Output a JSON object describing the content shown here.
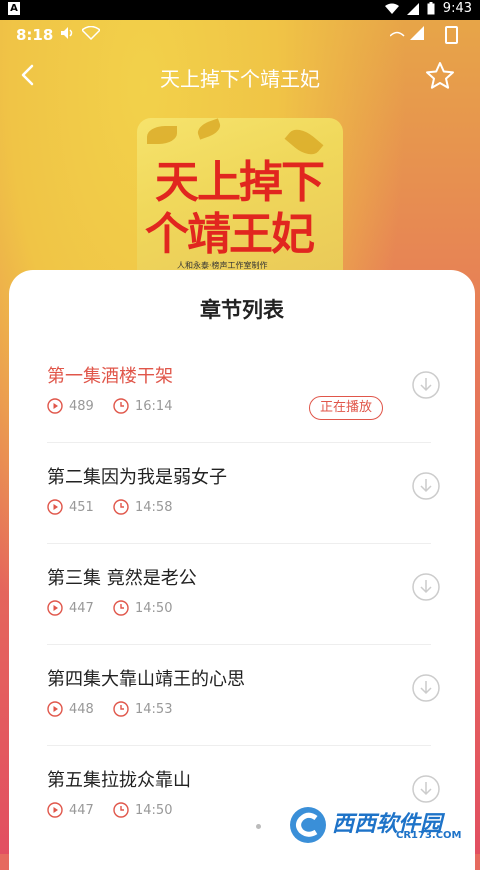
{
  "system_bar": {
    "time": "9:43",
    "app_indicator": "A"
  },
  "inner_status": {
    "time": "8:18"
  },
  "header": {
    "title": "天上掉下个靖王妃"
  },
  "cover": {
    "title_line1": "天上掉下",
    "title_line2": "个靖王妃",
    "caption": "人和永泰·榜声工作室制作"
  },
  "panel": {
    "title": "章节列表",
    "chapters": [
      {
        "name": "第一集酒楼干架",
        "plays": "489",
        "duration": "16:14",
        "badge": "正在播放"
      },
      {
        "name": "第二集因为我是弱女子",
        "plays": "451",
        "duration": "14:58"
      },
      {
        "name": "第三集 竟然是老公",
        "plays": "447",
        "duration": "14:50"
      },
      {
        "name": "第四集大靠山靖王的心思",
        "plays": "448",
        "duration": "14:53"
      },
      {
        "name": "第五集拉拢众靠山",
        "plays": "447",
        "duration": "14:50"
      }
    ]
  },
  "watermark": {
    "name": "西西软件园",
    "url": "CR173.COM"
  },
  "colors": {
    "accent": "#e0564a",
    "panel_bg": "#ffffff",
    "header_gradient_top": "#e7a548",
    "header_gradient_bottom": "#e24f61"
  },
  "icons": [
    "back-icon",
    "star-icon",
    "play-count-icon",
    "clock-icon",
    "download-icon",
    "wifi-icon",
    "battery-icon"
  ]
}
